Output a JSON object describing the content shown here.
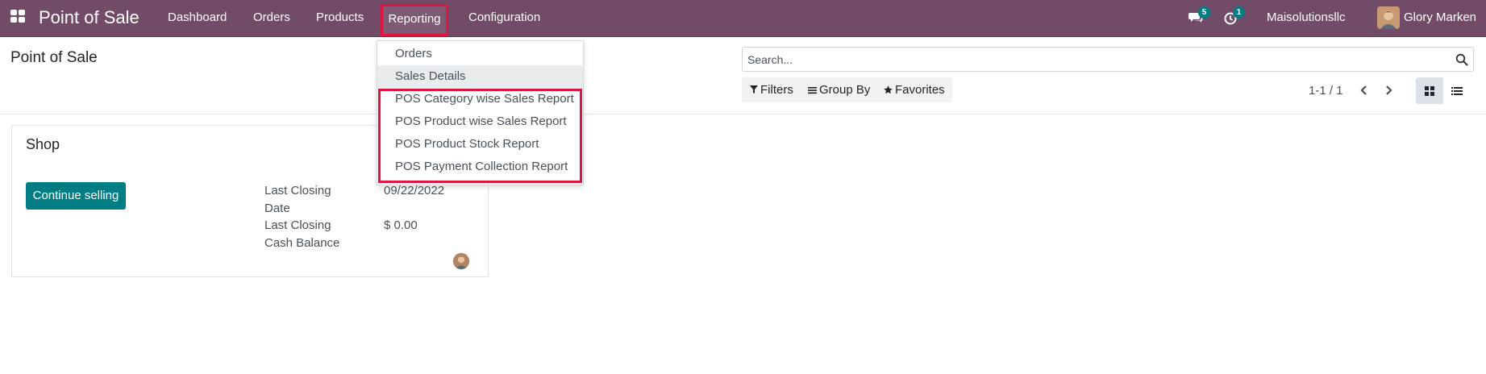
{
  "navbar": {
    "brand": "Point of Sale",
    "menu": {
      "dashboard": "Dashboard",
      "orders": "Orders",
      "products": "Products",
      "reporting": "Reporting",
      "configuration": "Configuration"
    },
    "messages_badge": "5",
    "activities_badge": "1",
    "company": "Maisolutionsllc",
    "user_name": "Glory Marken",
    "accent_color": "#714b67",
    "highlight_color": "#e0143c"
  },
  "control_panel": {
    "title": "Point of Sale",
    "search_placeholder": "Search...",
    "filters_label": "Filters",
    "group_by_label": "Group By",
    "favorites_label": "Favorites",
    "pager": "1-1 / 1"
  },
  "reporting_menu": {
    "items": [
      "Orders",
      "Sales Details",
      "POS Category wise Sales Report",
      "POS Product wise Sales Report",
      "POS Product Stock Report",
      "POS Payment Collection Report"
    ],
    "active_item": "Sales Details"
  },
  "card": {
    "title": "Shop",
    "button_label": "Continue selling",
    "last_closing_date_label": "Last Closing Date",
    "last_closing_date_value": "09/22/2022",
    "last_closing_cash_label": "Last Closing Cash Balance",
    "last_closing_cash_value": "$ 0.00",
    "button_color": "#017e84"
  }
}
